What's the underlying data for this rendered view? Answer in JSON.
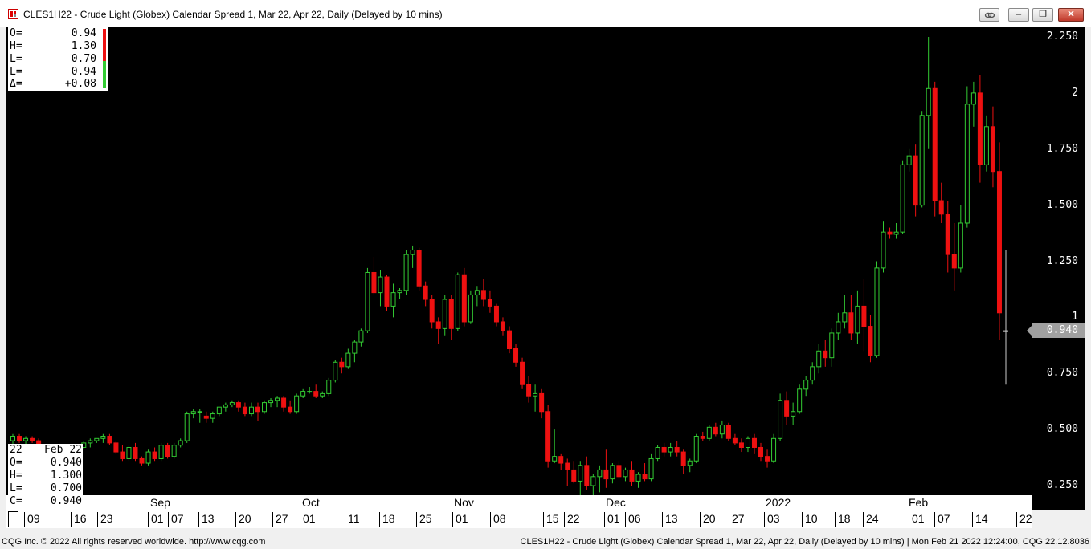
{
  "window": {
    "title": "CLES1H22 - Crude Light (Globex) Calendar Spread 1, Mar 22, Apr 22, Daily (Delayed by 10 mins)",
    "buttons": {
      "link": "link-icon",
      "minimize": "–",
      "restore": "❐",
      "close": "✕"
    }
  },
  "colors": {
    "up": "#33cc33",
    "down": "#ee1111",
    "background": "#000000",
    "axis_text": "#ffffff"
  },
  "ohlc_box": {
    "rows": [
      {
        "k": "O=",
        "v": "0.94"
      },
      {
        "k": "H=",
        "v": "1.30"
      },
      {
        "k": "L=",
        "v": "0.70"
      },
      {
        "k": "L=",
        "v": "0.94"
      },
      {
        "k": "Δ=",
        "v": "+0.08"
      }
    ]
  },
  "cursor_box": {
    "rows": [
      {
        "k": "22",
        "v": "Feb 22"
      },
      {
        "k": "O=",
        "v": "0.940"
      },
      {
        "k": "H=",
        "v": "1.300"
      },
      {
        "k": "L=",
        "v": "0.700"
      },
      {
        "k": "C=",
        "v": "0.940"
      }
    ]
  },
  "y_axis": {
    "ticks": [
      "2.250",
      "2",
      "1.750",
      "1.500",
      "1.250",
      "1",
      "0.750",
      "0.500",
      "0.250"
    ],
    "current_price": "0.940"
  },
  "x_axis": {
    "months": [
      "Sep",
      "Oct",
      "Nov",
      "Dec",
      "2022",
      "Feb"
    ],
    "days": [
      "09",
      "16",
      "23",
      "01",
      "07",
      "13",
      "20",
      "27",
      "01",
      "11",
      "18",
      "25",
      "01",
      "08",
      "15",
      "22",
      "01",
      "06",
      "13",
      "20",
      "27",
      "03",
      "10",
      "18",
      "24",
      "01",
      "07",
      "14",
      "22"
    ]
  },
  "chart_data": {
    "type": "candlestick",
    "ylim": [
      0.1,
      2.3
    ],
    "x": [
      "2021-08-09",
      "2021-08-10",
      "2021-08-11",
      "2021-08-12",
      "2021-08-13",
      "2021-08-16",
      "2021-08-17",
      "2021-08-18",
      "2021-08-19",
      "2021-08-20",
      "2021-08-23",
      "2021-08-24",
      "2021-08-25",
      "2021-08-26",
      "2021-08-27",
      "2021-08-30",
      "2021-08-31",
      "2021-09-01",
      "2021-09-02",
      "2021-09-03",
      "2021-09-07",
      "2021-09-08",
      "2021-09-09",
      "2021-09-10",
      "2021-09-13",
      "2021-09-14",
      "2021-09-15",
      "2021-09-16",
      "2021-09-17",
      "2021-09-20",
      "2021-09-21",
      "2021-09-22",
      "2021-09-23",
      "2021-09-24",
      "2021-09-27",
      "2021-09-28",
      "2021-09-29",
      "2021-09-30",
      "2021-10-01",
      "2021-10-04",
      "2021-10-05",
      "2021-10-06",
      "2021-10-07",
      "2021-10-08",
      "2021-10-11",
      "2021-10-12",
      "2021-10-13",
      "2021-10-14",
      "2021-10-15",
      "2021-10-18",
      "2021-10-19",
      "2021-10-20",
      "2021-10-21",
      "2021-10-22",
      "2021-10-25",
      "2021-10-26",
      "2021-10-27",
      "2021-10-28",
      "2021-10-29",
      "2021-11-01",
      "2021-11-02",
      "2021-11-03",
      "2021-11-04",
      "2021-11-05",
      "2021-11-08",
      "2021-11-09",
      "2021-11-10",
      "2021-11-11",
      "2021-11-12",
      "2021-11-15",
      "2021-11-16",
      "2021-11-17",
      "2021-11-18",
      "2021-11-19",
      "2021-11-22",
      "2021-11-23",
      "2021-11-24",
      "2021-11-26",
      "2021-11-29",
      "2021-11-30",
      "2021-12-01",
      "2021-12-02",
      "2021-12-03",
      "2021-12-06",
      "2021-12-07",
      "2021-12-08",
      "2021-12-09",
      "2021-12-10",
      "2021-12-13",
      "2021-12-14",
      "2021-12-15",
      "2021-12-16",
      "2021-12-17",
      "2021-12-20",
      "2021-12-21",
      "2021-12-22",
      "2021-12-23",
      "2021-12-27",
      "2021-12-28",
      "2021-12-29",
      "2021-12-30",
      "2021-12-31",
      "2022-01-03",
      "2022-01-04",
      "2022-01-05",
      "2022-01-06",
      "2022-01-07",
      "2022-01-10",
      "2022-01-11",
      "2022-01-12",
      "2022-01-13",
      "2022-01-14",
      "2022-01-18",
      "2022-01-19",
      "2022-01-20",
      "2022-01-21",
      "2022-01-24",
      "2022-01-25",
      "2022-01-26",
      "2022-01-27",
      "2022-01-28",
      "2022-01-31",
      "2022-02-01",
      "2022-02-02",
      "2022-02-03",
      "2022-02-04",
      "2022-02-07",
      "2022-02-08",
      "2022-02-09",
      "2022-02-10",
      "2022-02-11",
      "2022-02-14",
      "2022-02-15",
      "2022-02-16",
      "2022-02-17",
      "2022-02-18",
      "2022-02-22"
    ],
    "ohlc": [
      [
        0.45,
        0.48,
        0.43,
        0.47
      ],
      [
        0.47,
        0.48,
        0.44,
        0.45
      ],
      [
        0.45,
        0.47,
        0.43,
        0.46
      ],
      [
        0.46,
        0.47,
        0.44,
        0.45
      ],
      [
        0.45,
        0.46,
        0.41,
        0.42
      ],
      [
        0.42,
        0.43,
        0.38,
        0.39
      ],
      [
        0.39,
        0.4,
        0.35,
        0.36
      ],
      [
        0.31,
        0.34,
        0.3,
        0.33
      ],
      [
        0.33,
        0.34,
        0.31,
        0.32
      ],
      [
        0.32,
        0.36,
        0.31,
        0.35
      ],
      [
        0.35,
        0.43,
        0.34,
        0.42
      ],
      [
        0.42,
        0.45,
        0.41,
        0.44
      ],
      [
        0.44,
        0.46,
        0.42,
        0.45
      ],
      [
        0.45,
        0.46,
        0.44,
        0.46
      ],
      [
        0.46,
        0.48,
        0.44,
        0.47
      ],
      [
        0.47,
        0.48,
        0.43,
        0.44
      ],
      [
        0.44,
        0.45,
        0.39,
        0.4
      ],
      [
        0.4,
        0.43,
        0.36,
        0.37
      ],
      [
        0.37,
        0.43,
        0.36,
        0.42
      ],
      [
        0.42,
        0.44,
        0.36,
        0.37
      ],
      [
        0.37,
        0.38,
        0.34,
        0.35
      ],
      [
        0.35,
        0.41,
        0.34,
        0.4
      ],
      [
        0.4,
        0.42,
        0.36,
        0.37
      ],
      [
        0.37,
        0.44,
        0.36,
        0.43
      ],
      [
        0.43,
        0.44,
        0.37,
        0.38
      ],
      [
        0.38,
        0.44,
        0.37,
        0.43
      ],
      [
        0.43,
        0.46,
        0.42,
        0.45
      ],
      [
        0.45,
        0.58,
        0.44,
        0.57
      ],
      [
        0.57,
        0.59,
        0.55,
        0.58
      ],
      [
        0.58,
        0.59,
        0.53,
        0.58
      ],
      [
        0.56,
        0.58,
        0.53,
        0.55
      ],
      [
        0.55,
        0.58,
        0.53,
        0.57
      ],
      [
        0.57,
        0.6,
        0.56,
        0.6
      ],
      [
        0.6,
        0.62,
        0.58,
        0.61
      ],
      [
        0.61,
        0.63,
        0.6,
        0.62
      ],
      [
        0.62,
        0.63,
        0.58,
        0.6
      ],
      [
        0.6,
        0.62,
        0.56,
        0.57
      ],
      [
        0.57,
        0.62,
        0.56,
        0.6
      ],
      [
        0.6,
        0.62,
        0.54,
        0.58
      ],
      [
        0.58,
        0.63,
        0.57,
        0.62
      ],
      [
        0.62,
        0.64,
        0.6,
        0.63
      ],
      [
        0.63,
        0.65,
        0.6,
        0.64
      ],
      [
        0.64,
        0.65,
        0.58,
        0.6
      ],
      [
        0.6,
        0.63,
        0.57,
        0.58
      ],
      [
        0.58,
        0.66,
        0.57,
        0.65
      ],
      [
        0.65,
        0.68,
        0.64,
        0.67
      ],
      [
        0.67,
        0.69,
        0.66,
        0.67
      ],
      [
        0.67,
        0.7,
        0.64,
        0.65
      ],
      [
        0.65,
        0.67,
        0.64,
        0.66
      ],
      [
        0.66,
        0.73,
        0.65,
        0.72
      ],
      [
        0.72,
        0.81,
        0.71,
        0.8
      ],
      [
        0.8,
        0.82,
        0.75,
        0.78
      ],
      [
        0.78,
        0.86,
        0.77,
        0.84
      ],
      [
        0.84,
        0.9,
        0.8,
        0.89
      ],
      [
        0.89,
        0.95,
        0.87,
        0.94
      ],
      [
        0.94,
        1.22,
        0.93,
        1.2
      ],
      [
        1.2,
        1.27,
        1.1,
        1.11
      ],
      [
        1.11,
        1.21,
        1.05,
        1.18
      ],
      [
        1.18,
        1.19,
        1.03,
        1.05
      ],
      [
        1.05,
        1.15,
        1.0,
        1.11
      ],
      [
        1.11,
        1.13,
        1.08,
        1.12
      ],
      [
        1.12,
        1.3,
        1.1,
        1.28
      ],
      [
        1.28,
        1.32,
        1.22,
        1.3
      ],
      [
        1.3,
        1.31,
        1.12,
        1.14
      ],
      [
        1.14,
        1.16,
        1.05,
        1.08
      ],
      [
        1.08,
        1.1,
        0.95,
        0.98
      ],
      [
        0.98,
        1.0,
        0.88,
        0.95
      ],
      [
        0.95,
        1.1,
        0.92,
        1.08
      ],
      [
        1.08,
        1.1,
        0.9,
        0.95
      ],
      [
        0.95,
        1.2,
        0.94,
        1.19
      ],
      [
        1.19,
        1.22,
        0.96,
        0.98
      ],
      [
        0.98,
        1.12,
        0.97,
        1.1
      ],
      [
        1.1,
        1.14,
        1.05,
        1.12
      ],
      [
        1.12,
        1.17,
        1.05,
        1.08
      ],
      [
        1.08,
        1.12,
        1.02,
        1.05
      ],
      [
        1.05,
        1.06,
        0.96,
        0.98
      ],
      [
        0.98,
        1.0,
        0.92,
        0.94
      ],
      [
        0.94,
        0.96,
        0.84,
        0.86
      ],
      [
        0.86,
        0.88,
        0.78,
        0.8
      ],
      [
        0.8,
        0.82,
        0.68,
        0.7
      ],
      [
        0.7,
        0.74,
        0.62,
        0.65
      ],
      [
        0.65,
        0.7,
        0.58,
        0.66
      ],
      [
        0.66,
        0.68,
        0.55,
        0.58
      ],
      [
        0.58,
        0.61,
        0.33,
        0.36
      ],
      [
        0.36,
        0.5,
        0.35,
        0.38
      ],
      [
        0.38,
        0.39,
        0.32,
        0.35
      ],
      [
        0.35,
        0.37,
        0.25,
        0.32
      ],
      [
        0.32,
        0.36,
        0.26,
        0.27
      ],
      [
        0.27,
        0.36,
        0.2,
        0.34
      ],
      [
        0.34,
        0.38,
        0.23,
        0.25
      ],
      [
        0.25,
        0.3,
        0.2,
        0.29
      ],
      [
        0.29,
        0.34,
        0.22,
        0.32
      ],
      [
        0.32,
        0.41,
        0.24,
        0.28
      ],
      [
        0.28,
        0.35,
        0.26,
        0.34
      ],
      [
        0.34,
        0.36,
        0.28,
        0.29
      ],
      [
        0.29,
        0.33,
        0.27,
        0.32
      ],
      [
        0.32,
        0.36,
        0.25,
        0.27
      ],
      [
        0.27,
        0.31,
        0.24,
        0.3
      ],
      [
        0.3,
        0.35,
        0.27,
        0.28
      ],
      [
        0.28,
        0.39,
        0.27,
        0.37
      ],
      [
        0.37,
        0.43,
        0.36,
        0.42
      ],
      [
        0.42,
        0.44,
        0.38,
        0.4
      ],
      [
        0.4,
        0.44,
        0.38,
        0.42
      ],
      [
        0.42,
        0.45,
        0.38,
        0.4
      ],
      [
        0.4,
        0.41,
        0.3,
        0.34
      ],
      [
        0.34,
        0.37,
        0.31,
        0.36
      ],
      [
        0.36,
        0.48,
        0.35,
        0.47
      ],
      [
        0.47,
        0.49,
        0.45,
        0.46
      ],
      [
        0.46,
        0.52,
        0.45,
        0.51
      ],
      [
        0.51,
        0.53,
        0.47,
        0.48
      ],
      [
        0.48,
        0.54,
        0.46,
        0.52
      ],
      [
        0.52,
        0.53,
        0.45,
        0.46
      ],
      [
        0.46,
        0.48,
        0.43,
        0.44
      ],
      [
        0.44,
        0.46,
        0.4,
        0.42
      ],
      [
        0.42,
        0.47,
        0.4,
        0.46
      ],
      [
        0.46,
        0.48,
        0.39,
        0.42
      ],
      [
        0.42,
        0.44,
        0.36,
        0.38
      ],
      [
        0.38,
        0.41,
        0.33,
        0.36
      ],
      [
        0.36,
        0.48,
        0.35,
        0.46
      ],
      [
        0.46,
        0.66,
        0.45,
        0.63
      ],
      [
        0.63,
        0.67,
        0.52,
        0.56
      ],
      [
        0.56,
        0.62,
        0.52,
        0.58
      ],
      [
        0.58,
        0.7,
        0.57,
        0.68
      ],
      [
        0.68,
        0.74,
        0.65,
        0.72
      ],
      [
        0.72,
        0.8,
        0.7,
        0.78
      ],
      [
        0.78,
        0.88,
        0.75,
        0.85
      ],
      [
        0.85,
        0.9,
        0.78,
        0.82
      ],
      [
        0.82,
        0.95,
        0.78,
        0.93
      ],
      [
        0.93,
        1.02,
        0.9,
        0.98
      ],
      [
        0.98,
        1.1,
        0.95,
        1.02
      ],
      [
        1.02,
        1.1,
        0.9,
        0.93
      ],
      [
        0.93,
        1.12,
        0.88,
        1.05
      ],
      [
        1.05,
        1.17,
        0.85,
        0.96
      ],
      [
        0.96,
        1.01,
        0.8,
        0.83
      ],
      [
        0.83,
        1.25,
        0.82,
        1.22
      ],
      [
        1.22,
        1.43,
        1.2,
        1.38
      ],
      [
        1.38,
        1.4,
        1.35,
        1.37
      ],
      [
        1.37,
        1.42,
        1.35,
        1.38
      ],
      [
        1.38,
        1.7,
        1.37,
        1.68
      ],
      [
        1.68,
        1.75,
        1.65,
        1.72
      ],
      [
        1.72,
        1.77,
        1.45,
        1.5
      ],
      [
        1.5,
        1.92,
        1.49,
        1.9
      ],
      [
        1.9,
        2.25,
        1.75,
        2.02
      ],
      [
        2.02,
        2.05,
        1.45,
        1.52
      ],
      [
        1.52,
        1.6,
        1.42,
        1.46
      ],
      [
        1.46,
        1.52,
        1.2,
        1.28
      ],
      [
        1.28,
        1.42,
        1.12,
        1.22
      ],
      [
        1.22,
        1.5,
        1.2,
        1.42
      ],
      [
        1.42,
        2.03,
        1.4,
        1.95
      ],
      [
        1.95,
        2.05,
        1.85,
        2.0
      ],
      [
        2.0,
        2.08,
        1.6,
        1.68
      ],
      [
        1.68,
        1.9,
        1.65,
        1.85
      ],
      [
        1.85,
        1.94,
        1.58,
        1.65
      ],
      [
        1.65,
        1.78,
        0.9,
        1.02
      ],
      [
        0.94,
        1.3,
        0.7,
        0.94
      ]
    ]
  },
  "status": {
    "left": "CQG Inc. © 2022 All rights reserved worldwide. http://www.cqg.com",
    "right": "CLES1H22 - Crude Light (Globex) Calendar Spread 1, Mar 22, Apr 22, Daily (Delayed by 10 mins) | Mon Feb 21 2022 12:24:00, CQG 22.12.8036"
  }
}
